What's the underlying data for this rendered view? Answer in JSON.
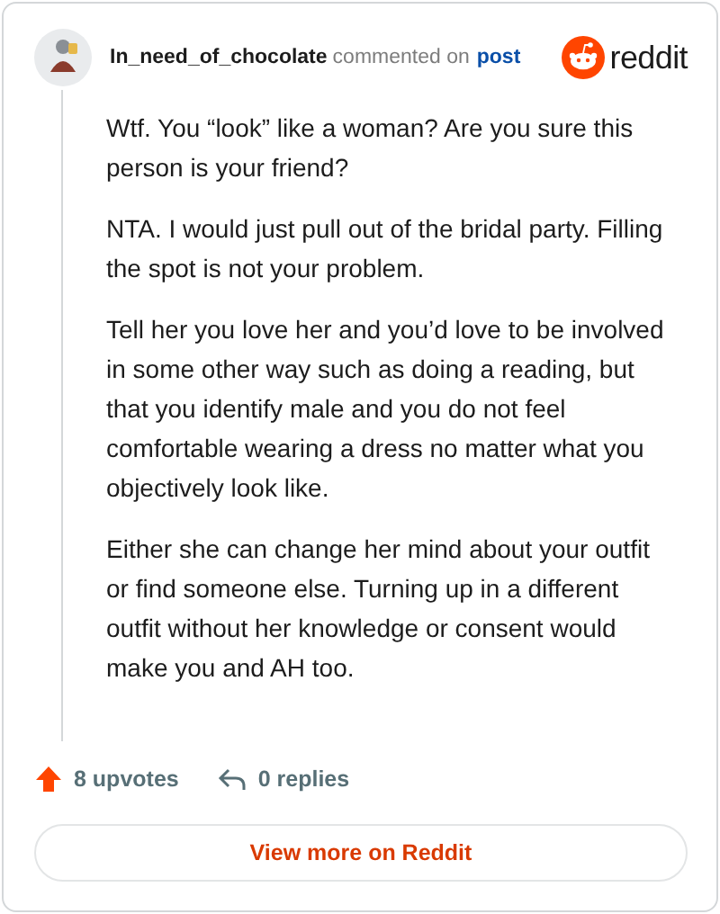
{
  "header": {
    "author": "In_need_of_chocolate",
    "action": "commented on",
    "link": "post",
    "brand": "reddit"
  },
  "paragraphs": [
    "Wtf. You “look” like a woman? Are you sure this person is your friend?",
    "NTA. I would just pull out of the bridal party. Filling the spot is not your problem.",
    "Tell her you love her and you’d love to be involved in some other way such as doing a reading, but that you identify male and you do not feel comfortable wearing a dress no matter what you objectively look like.",
    "Either she can change her mind about your outfit or find someone else. Turning up in a different outfit without her knowledge or consent would make you and AH too."
  ],
  "footer": {
    "upvotes": "8 upvotes",
    "replies": "0 replies"
  },
  "button": "View more on Reddit"
}
